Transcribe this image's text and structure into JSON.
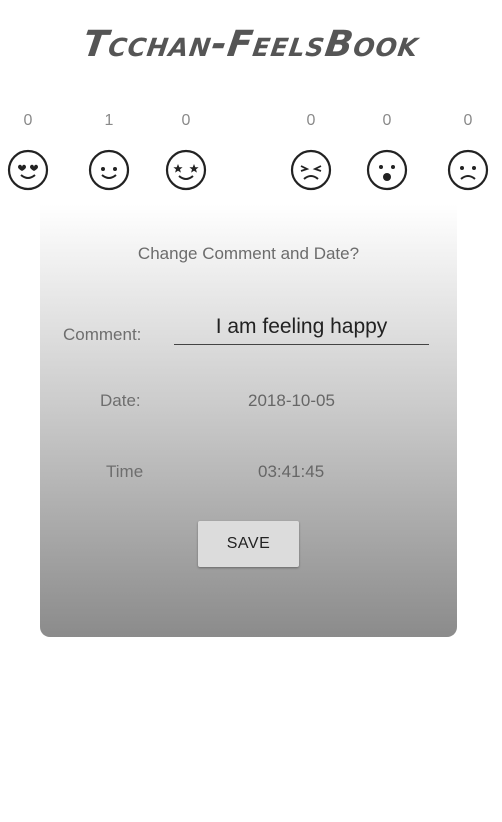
{
  "app": {
    "title": "Tcchan-FeelsBook"
  },
  "emotions": [
    {
      "count": "0",
      "icon": "love-face-icon"
    },
    {
      "count": "1",
      "icon": "smile-face-icon"
    },
    {
      "count": "0",
      "icon": "star-eyes-face-icon"
    },
    {
      "count": "0",
      "icon": "angry-face-icon"
    },
    {
      "count": "0",
      "icon": "surprised-face-icon"
    },
    {
      "count": "0",
      "icon": "sad-face-icon"
    }
  ],
  "dialog": {
    "title": "Change Comment and Date?",
    "comment_label": "Comment:",
    "comment_value": "I am feeling happy",
    "date_label": "Date:",
    "date_value": "2018-10-05",
    "time_label": "Time",
    "time_value": "03:41:45",
    "save_label": "SAVE"
  },
  "colors": {
    "dialog_gradient_top": "#ffffff",
    "dialog_gradient_bottom": "#8b8b8b",
    "button_bg": "#dcdcdc",
    "title_color": "#555555"
  }
}
